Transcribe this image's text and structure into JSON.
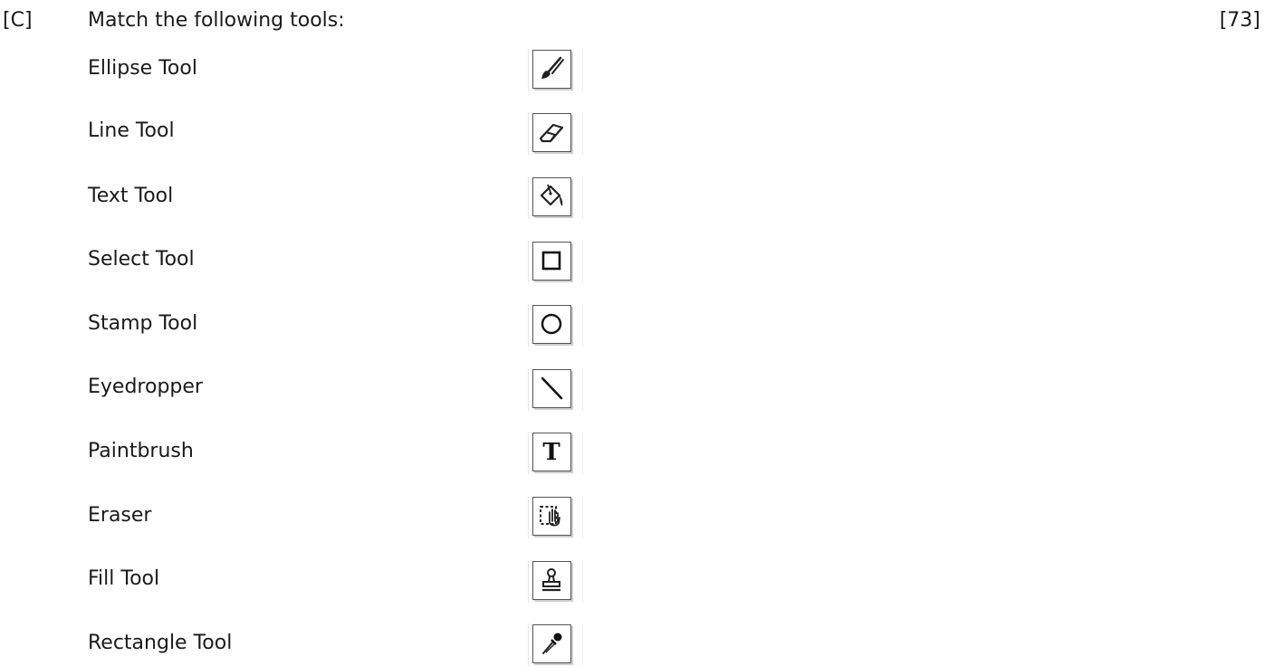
{
  "question": {
    "label": "[C]",
    "text": "Match the following tools:",
    "marks": "[73]"
  },
  "tools": [
    "Ellipse Tool",
    "Line Tool",
    "Text Tool",
    "Select Tool",
    "Stamp Tool",
    "Eyedropper",
    "Paintbrush",
    "Eraser",
    "Fill Tool",
    "Rectangle Tool"
  ],
  "icons": [
    {
      "name": "paintbrush-icon"
    },
    {
      "name": "eraser-icon"
    },
    {
      "name": "paint-bucket-icon"
    },
    {
      "name": "rectangle-icon"
    },
    {
      "name": "ellipse-icon"
    },
    {
      "name": "line-icon"
    },
    {
      "name": "text-icon",
      "glyph": "T"
    },
    {
      "name": "select-hand-icon"
    },
    {
      "name": "stamp-icon"
    },
    {
      "name": "eyedropper-icon"
    }
  ]
}
